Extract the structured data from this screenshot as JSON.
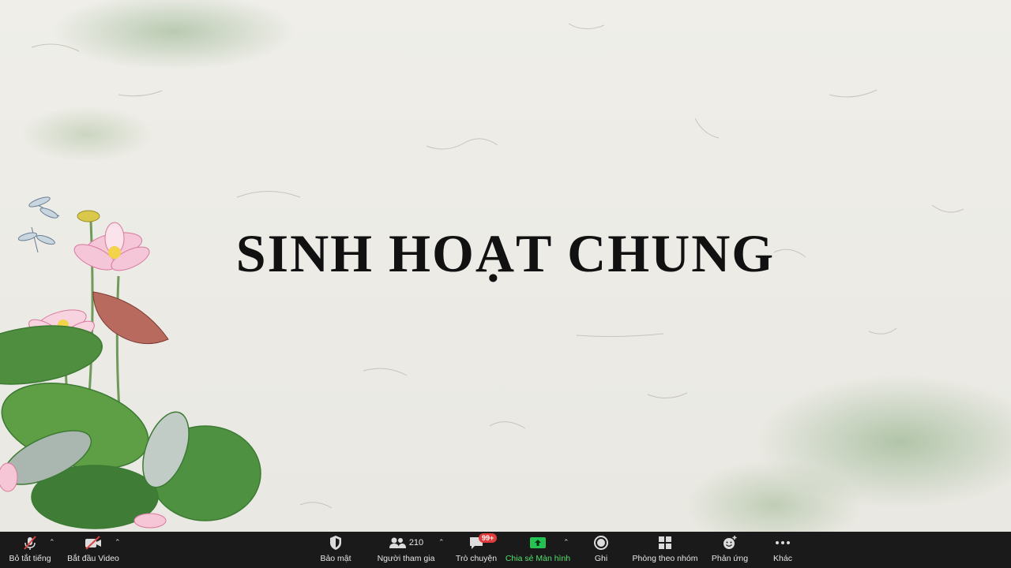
{
  "slide": {
    "title": "SINH HOẠT CHUNG"
  },
  "toolbar": {
    "mute_label": "Bỏ tắt tiếng",
    "video_label": "Bắt đầu Video",
    "security_label": "Bảo mật",
    "participants_label": "Người tham gia",
    "participants_count": "210",
    "chat_label": "Trò chuyện",
    "chat_badge": "99+",
    "share_label": "Chia sẻ Màn hình",
    "record_label": "Ghi",
    "breakout_label": "Phòng theo nhóm",
    "reactions_label": "Phản ứng",
    "more_label": "Khác"
  },
  "colors": {
    "toolbar_bg": "#1a1a1a",
    "share_green": "#23c552",
    "badge_red": "#e23b3b",
    "muted_red": "#e04040"
  }
}
